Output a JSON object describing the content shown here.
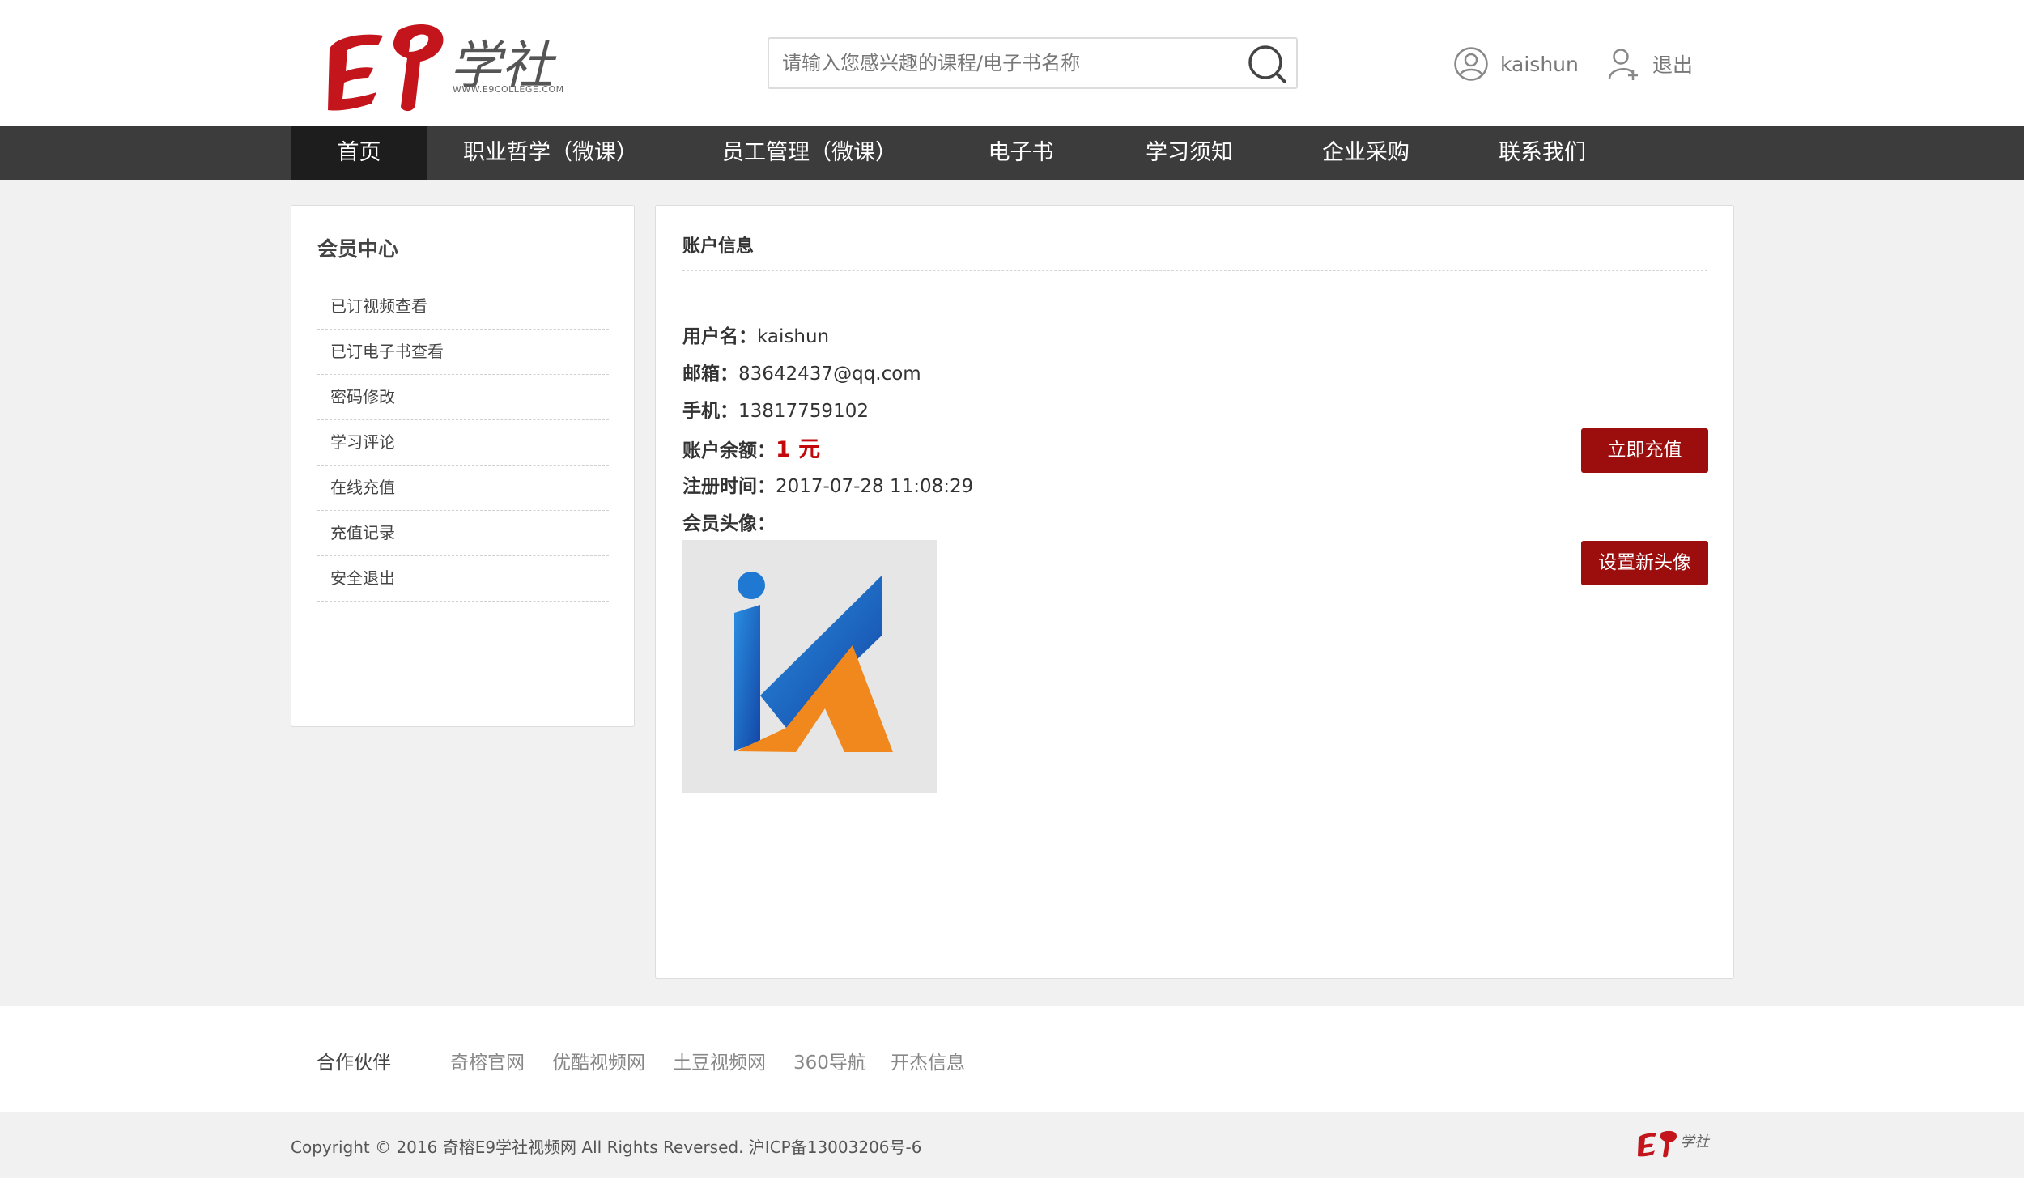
{
  "header": {
    "logo_text": "学社",
    "logo_url_text": "WWW.E9COLLEGE.COM",
    "search_placeholder": "请输入您感兴趣的课程/电子书名称",
    "username": "kaishun",
    "logout_label": "退出"
  },
  "nav": {
    "items": [
      {
        "label": "首页"
      },
      {
        "label": "职业哲学（微课）"
      },
      {
        "label": "员工管理（微课）"
      },
      {
        "label": "电子书"
      },
      {
        "label": "学习须知"
      },
      {
        "label": "企业采购"
      },
      {
        "label": "联系我们"
      }
    ]
  },
  "sidebar": {
    "title": "会员中心",
    "items": [
      {
        "label": "已订视频查看"
      },
      {
        "label": "已订电子书查看"
      },
      {
        "label": "密码修改"
      },
      {
        "label": "学习评论"
      },
      {
        "label": "在线充值"
      },
      {
        "label": "充值记录"
      },
      {
        "label": "安全退出"
      }
    ]
  },
  "account": {
    "title": "账户信息",
    "username_label": "用户名：",
    "username_value": "kaishun",
    "email_label": "邮箱：",
    "email_value": "83642437@qq.com",
    "phone_label": "手机：",
    "phone_value": "13817759102",
    "balance_label": "账户余额：",
    "balance_value": "1 元",
    "register_label": "注册时间：",
    "register_value": "2017-07-28 11:08:29",
    "avatar_label": "会员头像：",
    "recharge_button": "立即充值",
    "set_avatar_button": "设置新头像"
  },
  "footer": {
    "partners_label": "合作伙伴",
    "partners": [
      "奇榕官网",
      "优酷视频网",
      "土豆视频网",
      "360导航",
      "开杰信息"
    ],
    "copyright": "Copyright © 2016 奇榕E9学社视频网 All Rights Reversed. 沪ICP备13003206号-6"
  },
  "colors": {
    "nav_bg": "#3c3c3c",
    "nav_active": "#1d1d1d",
    "accent_red": "#9c0d0d",
    "balance_red": "#c4070b",
    "logo_red": "#c4151c"
  },
  "icons": {
    "search": "search-icon",
    "user": "user-circle-icon",
    "logout": "user-plus-icon"
  }
}
